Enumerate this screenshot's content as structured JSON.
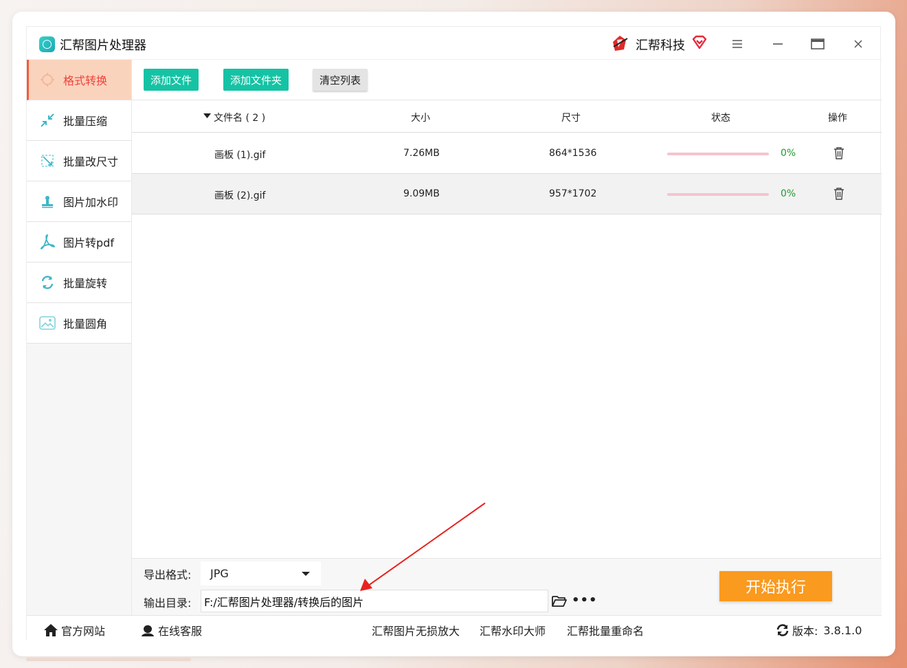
{
  "app": {
    "title": "汇帮图片处理器",
    "brand_name": "汇帮科技"
  },
  "sidebar": {
    "items": [
      {
        "label": "格式转换",
        "icon": "format-convert-icon",
        "active": true
      },
      {
        "label": "批量压缩",
        "icon": "compress-icon",
        "active": false
      },
      {
        "label": "批量改尺寸",
        "icon": "resize-icon",
        "active": false
      },
      {
        "label": "图片加水印",
        "icon": "watermark-icon",
        "active": false
      },
      {
        "label": "图片转pdf",
        "icon": "pdf-icon",
        "active": false
      },
      {
        "label": "批量旋转",
        "icon": "rotate-icon",
        "active": false
      },
      {
        "label": "批量圆角",
        "icon": "round-corner-icon",
        "active": false
      }
    ]
  },
  "toolbar": {
    "add_file": "添加文件",
    "add_folder": "添加文件夹",
    "clear_list": "清空列表"
  },
  "table": {
    "headers": {
      "filename": "文件名 ( 2 )",
      "size": "大小",
      "dimensions": "尺寸",
      "status": "状态",
      "action": "操作"
    },
    "rows": [
      {
        "filename": "画板 (1).gif",
        "size": "7.26MB",
        "dimensions": "864*1536",
        "progress": 0,
        "status": "0%"
      },
      {
        "filename": "画板 (2).gif",
        "size": "9.09MB",
        "dimensions": "957*1702",
        "progress": 0,
        "status": "0%"
      }
    ]
  },
  "output": {
    "format_label": "导出格式:",
    "format_value": "JPG",
    "dir_label": "输出目录:",
    "dir_value": "F:/汇帮图片处理器/转换后的图片",
    "start_button": "开始执行"
  },
  "footer": {
    "website": "官方网站",
    "support": "在线客服",
    "link1": "汇帮图片无损放大",
    "link2": "汇帮水印大师",
    "link3": "汇帮批量重命名",
    "version_label": "版本:",
    "version_value": "3.8.1.0"
  },
  "colors": {
    "accent_green": "#15c3a4",
    "active_tab_bg": "#fad3bd",
    "active_tab_text": "#f0413a",
    "start_button": "#fa9a1f",
    "status_text": "#1f9b2f",
    "annotation_arrow": "#e8231f"
  }
}
